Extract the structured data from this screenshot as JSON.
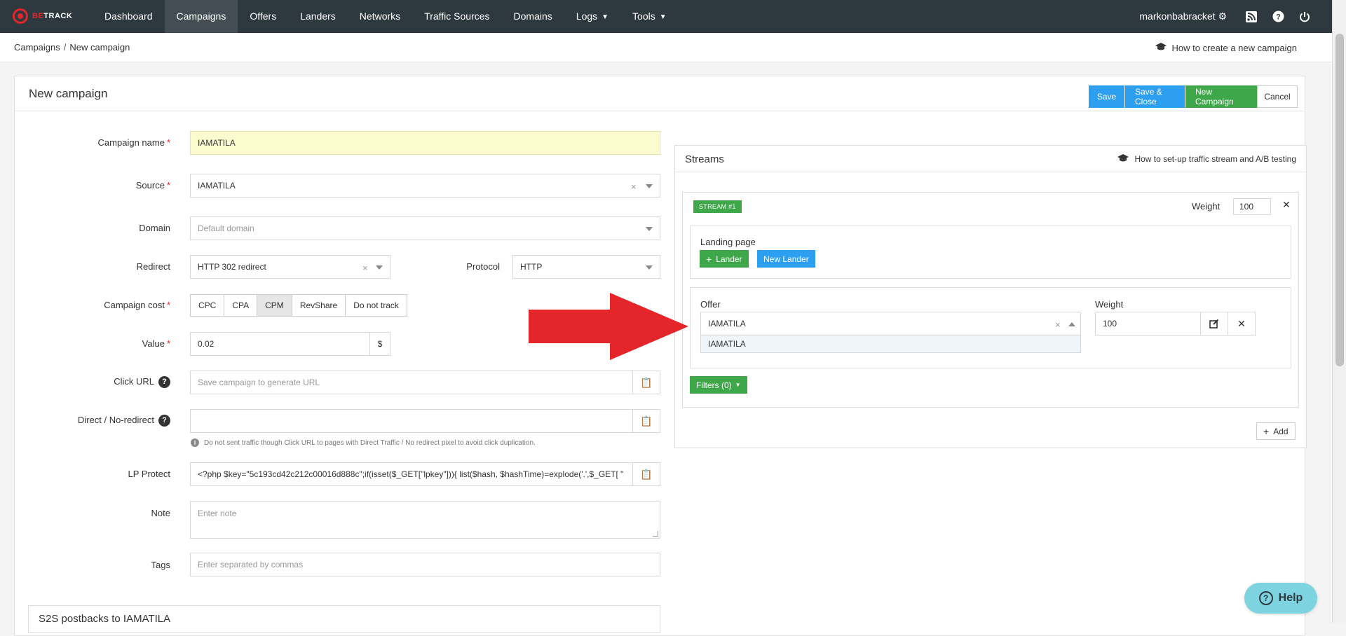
{
  "nav": {
    "logo_text_a": "BE",
    "logo_text_b": "TRACK",
    "items": [
      {
        "label": "Dashboard"
      },
      {
        "label": "Campaigns"
      },
      {
        "label": "Offers"
      },
      {
        "label": "Landers"
      },
      {
        "label": "Networks"
      },
      {
        "label": "Traffic Sources"
      },
      {
        "label": "Domains"
      },
      {
        "label": "Logs"
      },
      {
        "label": "Tools"
      }
    ],
    "user": "markonbabracket"
  },
  "breadcrumb": {
    "root": "Campaigns",
    "sep": "/",
    "current": "New campaign",
    "howto": "How to create a new campaign"
  },
  "panel": {
    "title": "New campaign",
    "buttons": {
      "save": "Save",
      "save_close": "Save & Close",
      "new_campaign": "New Campaign",
      "cancel": "Cancel"
    }
  },
  "form": {
    "campaign_name": {
      "label": "Campaign name",
      "value": "IAMATILA"
    },
    "source": {
      "label": "Source",
      "value": "IAMATILA"
    },
    "domain": {
      "label": "Domain",
      "placeholder": "Default domain"
    },
    "redirect": {
      "label": "Redirect",
      "value": "HTTP 302 redirect"
    },
    "protocol": {
      "label": "Protocol",
      "value": "HTTP"
    },
    "campaign_cost": {
      "label": "Campaign cost",
      "options": [
        "CPC",
        "CPA",
        "CPM",
        "RevShare",
        "Do not track"
      ],
      "selected": "CPM"
    },
    "value": {
      "label": "Value",
      "value": "0.02",
      "addon": "$"
    },
    "click_url": {
      "label": "Click URL",
      "placeholder": "Save campaign to generate URL"
    },
    "direct": {
      "label": "Direct / No-redirect",
      "hint": "Do not sent traffic though Click URL to pages with Direct Traffic / No redirect pixel to avoid click duplication."
    },
    "lp_protect": {
      "label": "LP Protect",
      "value": "<?php $key=\"5c193cd42c212c00016d888c\";if(isset($_GET[\"lpkey\"])){ list($hash, $hashTime)=explode('.',$_GET[ \""
    },
    "note": {
      "label": "Note",
      "placeholder": "Enter note"
    },
    "tags": {
      "label": "Tags",
      "placeholder": "Enter separated by commas"
    }
  },
  "streams": {
    "title": "Streams",
    "howto": "How to set-up traffic stream and A/B testing",
    "stream": {
      "badge": "STREAM #1",
      "weight_label": "Weight",
      "weight": "100",
      "landing_label": "Landing page",
      "lander_btn": "Lander",
      "new_lander_btn": "New Lander",
      "offer_label": "Offer",
      "offer_value": "IAMATILA",
      "offer_option": "IAMATILA",
      "offer_weight_label": "Weight",
      "offer_weight": "100",
      "filters_btn": "Filters (0)"
    },
    "add_btn": "Add"
  },
  "postbacks": {
    "title": "S2S postbacks to IAMATILA"
  },
  "help": {
    "label": "Help"
  },
  "colors": {
    "navbar": "#2e393f",
    "blue": "#2c9ff0",
    "green": "#3ea74a",
    "arrow": "#e4262b",
    "highlight": "#fbfbcf"
  }
}
